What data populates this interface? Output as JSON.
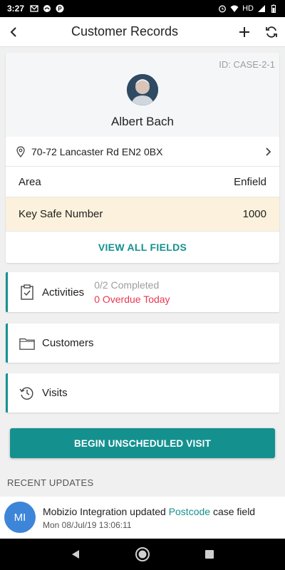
{
  "status_bar": {
    "time": "3:27",
    "network": "HD",
    "notification_icons": [
      "gmail-icon",
      "cloud-icon",
      "pinterest-icon"
    ],
    "system_icons": [
      "alarm-icon",
      "wifi-icon",
      "signal-icon",
      "battery-icon"
    ]
  },
  "app_bar": {
    "title": "Customer Records",
    "back_icon": "back-arrow-icon",
    "add_icon": "plus-icon",
    "refresh_icon": "refresh-icon"
  },
  "case": {
    "id": "ID: CASE-2-1",
    "name": "Albert Bach",
    "address": "70-72 Lancaster Rd  EN2 0BX",
    "fields": [
      {
        "label": "Area",
        "value": "Enfield"
      },
      {
        "label": "Key Safe Number",
        "value": "1000"
      }
    ],
    "view_all_label": "VIEW ALL FIELDS"
  },
  "sections": {
    "activities": {
      "label": "Activities",
      "completed": "0/2 Completed",
      "overdue": "0 Overdue Today"
    },
    "customers": {
      "label": "Customers"
    },
    "visits": {
      "label": "Visits"
    }
  },
  "begin_button": "BEGIN UNSCHEDULED VISIT",
  "recent": {
    "title": "RECENT UPDATES",
    "items": [
      {
        "initials": "MI",
        "actor": "Mobizio Integration updated",
        "field": "Postcode",
        "suffix": "case field",
        "time": "Mon 08/Jul/19 13:06:11"
      }
    ]
  },
  "colors": {
    "accent": "#14918f",
    "overdue": "#e53950",
    "highlight_row": "#fbf1dc",
    "avatar_bg": "#3d85d8"
  }
}
